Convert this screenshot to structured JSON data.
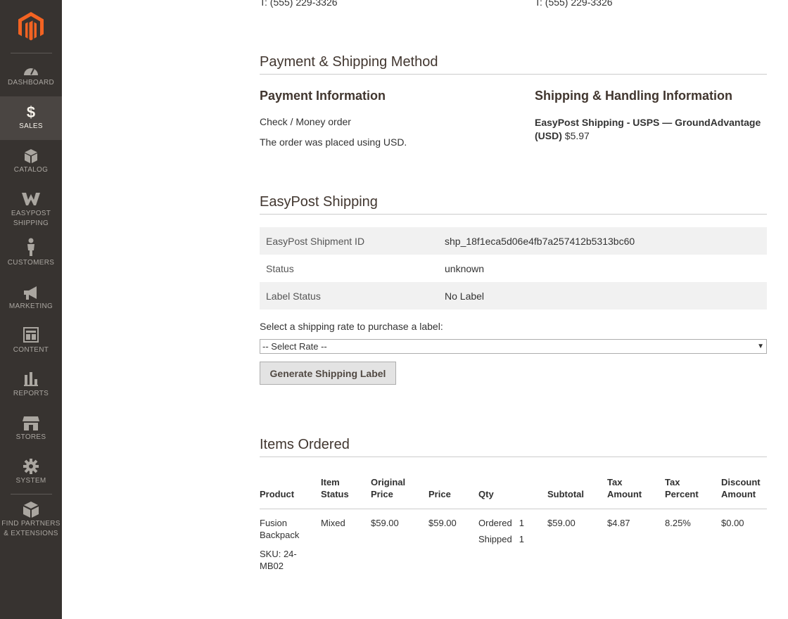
{
  "sidebar": {
    "items": [
      {
        "label": "Dashboard",
        "icon": "dashboard-icon"
      },
      {
        "label": "Sales",
        "icon": "dollar-icon",
        "active": true
      },
      {
        "label": "Catalog",
        "icon": "cube-icon"
      },
      {
        "label": "EasyPost Shipping",
        "icon": "easypost-icon"
      },
      {
        "label": "Customers",
        "icon": "person-icon"
      },
      {
        "label": "Marketing",
        "icon": "megaphone-icon"
      },
      {
        "label": "Content",
        "icon": "layout-icon"
      },
      {
        "label": "Reports",
        "icon": "bar-chart-icon"
      },
      {
        "label": "Stores",
        "icon": "store-icon"
      },
      {
        "label": "System",
        "icon": "gear-icon"
      },
      {
        "label": "Find Partners & Extensions",
        "icon": "boxes-icon"
      }
    ]
  },
  "address": {
    "billing_phone": "T: (555) 229-3326",
    "shipping_phone": "T: (555) 229-3326"
  },
  "payment_shipping": {
    "title": "Payment & Shipping Method",
    "payment_title": "Payment Information",
    "payment_method": "Check / Money order",
    "currency_note": "The order was placed using USD.",
    "shipping_title": "Shipping & Handling Information",
    "shipping_method_line1": "EasyPost Shipping - USPS — GroundAdvantage",
    "shipping_method_line2": "(USD)",
    "shipping_price": "$5.97"
  },
  "easypost": {
    "title": "EasyPost Shipping",
    "rows": [
      {
        "label": "EasyPost Shipment ID",
        "value": "shp_18f1eca5d06e4fb7a257412b5313bc60"
      },
      {
        "label": "Status",
        "value": "unknown"
      },
      {
        "label": "Label Status",
        "value": "No Label"
      }
    ],
    "select_label": "Select a shipping rate to purchase a label:",
    "select_value": "-- Select Rate --",
    "button_label": "Generate Shipping Label",
    "no_label_color": "#eb9b0b"
  },
  "items_ordered": {
    "title": "Items Ordered",
    "headers": [
      "Product",
      "Item Status",
      "Original Price",
      "Price",
      "Qty",
      "Subtotal",
      "Tax Amount",
      "Tax Percent",
      "Discount Amount"
    ],
    "header_lines": [
      [
        "",
        "Product"
      ],
      [
        "Item",
        "Status"
      ],
      [
        "Original",
        "Price"
      ],
      [
        "",
        "Price"
      ],
      [
        "",
        "Qty"
      ],
      [
        "",
        "Subtotal"
      ],
      [
        "Tax",
        "Amount"
      ],
      [
        "Tax",
        "Percent"
      ],
      [
        "Discount",
        "Amount"
      ]
    ],
    "rows": [
      {
        "product_line1": "Fusion",
        "product_line2": "Backpack",
        "sku_line1": "SKU: 24-",
        "sku_line2": "MB02",
        "item_status": "Mixed",
        "original_price": "$59.00",
        "price": "$59.00",
        "qty_ordered_label": "Ordered",
        "qty_ordered": "1",
        "qty_shipped_label": "Shipped",
        "qty_shipped": "1",
        "subtotal": "$59.00",
        "tax_amount": "$4.87",
        "tax_percent": "8.25%",
        "discount_amount": "$0.00"
      }
    ]
  }
}
